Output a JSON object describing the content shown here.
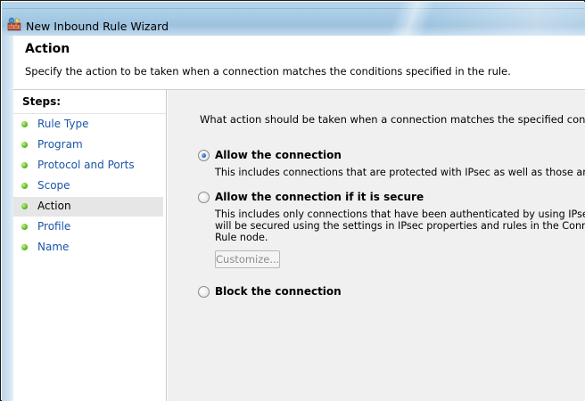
{
  "window": {
    "title": "New Inbound Rule Wizard",
    "icon": "firewall-wizard-icon"
  },
  "header": {
    "title": "Action",
    "description": "Specify the action to be taken when a connection matches the conditions specified in the rule."
  },
  "steps": {
    "title": "Steps:",
    "items": [
      {
        "label": "Rule Type",
        "selected": false
      },
      {
        "label": "Program",
        "selected": false
      },
      {
        "label": "Protocol and Ports",
        "selected": false
      },
      {
        "label": "Scope",
        "selected": false
      },
      {
        "label": "Action",
        "selected": true
      },
      {
        "label": "Profile",
        "selected": false
      },
      {
        "label": "Name",
        "selected": false
      }
    ]
  },
  "main": {
    "question": "What action should be taken when a connection matches the specified conditions?",
    "options": [
      {
        "label": "Allow the connection",
        "checked": true,
        "description": [
          "This includes connections that are protected with IPsec as well as those are not."
        ]
      },
      {
        "label": "Allow the connection if it is secure",
        "checked": false,
        "description": [
          "This includes only connections that have been authenticated by using IPsec.  Connectio",
          "will be secured using the settings in IPsec properties and rules in the Connection Security",
          "Rule node."
        ]
      },
      {
        "label": "Block the connection",
        "checked": false,
        "description": []
      }
    ],
    "customize_label": "Customize..."
  },
  "colors": {
    "step_link": "#1a56a8",
    "step_selected_bg": "#e6e6e6",
    "main_bg": "#f0f0f0",
    "titlebar": "#a9cce6"
  }
}
